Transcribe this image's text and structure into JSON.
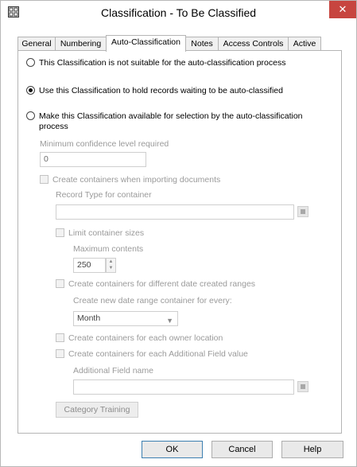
{
  "window": {
    "title": "Classification - To Be Classified",
    "close_label": "✕"
  },
  "tabs": [
    {
      "label": "General"
    },
    {
      "label": "Numbering"
    },
    {
      "label": "Auto-Classification"
    },
    {
      "label": "Notes"
    },
    {
      "label": "Access Controls"
    },
    {
      "label": "Active"
    }
  ],
  "active_tab": "Auto-Classification",
  "options": {
    "not_suitable": "This Classification is not suitable for the auto-classification process",
    "hold_records": "Use this Classification to hold records waiting to be auto-classified",
    "make_available": "Make this Classification available for selection by the auto-classification",
    "make_available_line2": "process",
    "selected": "hold_records"
  },
  "min_confidence": {
    "label": "Minimum confidence level required",
    "value": "0"
  },
  "create_containers": {
    "label": "Create containers when importing documents",
    "checked": false
  },
  "record_type": {
    "label": "Record Type for container",
    "value": ""
  },
  "limit_sizes": {
    "label": "Limit container sizes",
    "checked": false
  },
  "max_contents": {
    "label": "Maximum contents",
    "value": "250"
  },
  "date_ranges": {
    "label": "Create containers for different date created ranges",
    "checked": false
  },
  "date_range_every": {
    "label": "Create new date range container for every:",
    "value": "Month"
  },
  "owner_location": {
    "label": "Create containers for each owner location",
    "checked": false
  },
  "additional_field": {
    "label": "Create containers for each Additional Field value",
    "checked": false
  },
  "additional_field_name": {
    "label": "Additional Field name",
    "value": ""
  },
  "category_training_label": "Category Training",
  "buttons": {
    "ok": "OK",
    "cancel": "Cancel",
    "help": "Help"
  }
}
